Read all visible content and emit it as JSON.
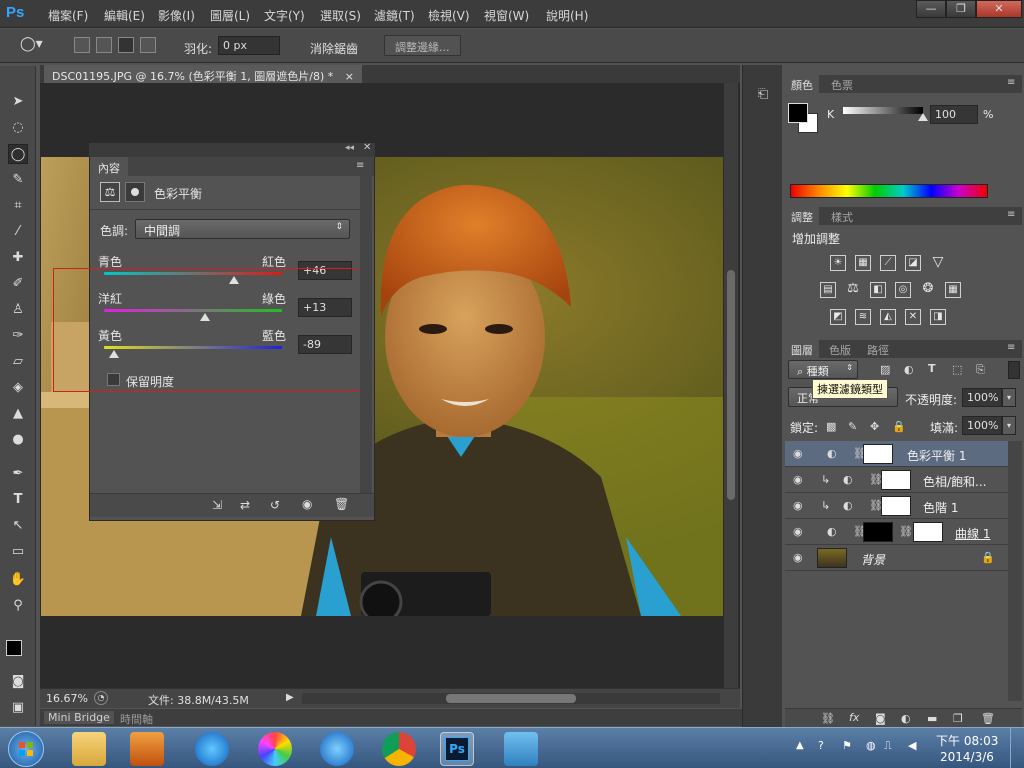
{
  "app": {
    "logo": "Ps"
  },
  "menu": [
    "檔案(F)",
    "編輯(E)",
    "影像(I)",
    "圖層(L)",
    "文字(Y)",
    "選取(S)",
    "濾鏡(T)",
    "檢視(V)",
    "視窗(W)",
    "說明(H)"
  ],
  "window_controls": {
    "minimize": "—",
    "restore": "❐",
    "close": "✕"
  },
  "options_bar": {
    "feather_label": "羽化:",
    "feather_value": "0 px",
    "antialias_label": "消除鋸齒",
    "antialias_checked": "✓",
    "refine_edge_button": "調整邊緣..."
  },
  "document": {
    "tab_title": "DSC01195.JPG @ 16.7% (色彩平衡 1, 圖層遮色片/8) *",
    "tab_close": "×",
    "zoom": "16.67%",
    "file_info": "文件: 38.8M/43.5M"
  },
  "bottom_tabs": [
    "Mini Bridge",
    "時間軸"
  ],
  "properties": {
    "tab_label": "內容",
    "adjustment_title": "色彩平衡",
    "tone_label": "色調:",
    "tone_value": "中間調",
    "sliders": [
      {
        "left": "青色",
        "right": "紅色",
        "value": "+46",
        "fraction": 0.73,
        "gradient": [
          "#00c8c8",
          "#e01818"
        ]
      },
      {
        "left": "洋紅",
        "right": "綠色",
        "value": "+13",
        "fraction": 0.565,
        "gradient": [
          "#e020e0",
          "#20c020"
        ]
      },
      {
        "left": "黃色",
        "right": "藍色",
        "value": "-89",
        "fraction": 0.055,
        "gradient": [
          "#e0e020",
          "#2020e0"
        ]
      }
    ],
    "preserve_label": "保留明度"
  },
  "color_panel": {
    "tabs": [
      "顏色",
      "色票"
    ],
    "channel_label": "K",
    "value": "100",
    "unit": "%",
    "slider_fraction": 1.0
  },
  "adjustments_panel": {
    "tabs": [
      "調整",
      "樣式"
    ],
    "heading": "增加調整",
    "icons_row1": [
      "brightness-icon",
      "levels-icon",
      "curves-icon",
      "exposure-icon",
      "vibrance-icon"
    ],
    "icons_row2": [
      "hue-saturation-icon",
      "color-balance-icon",
      "black-white-icon",
      "photo-filter-icon",
      "channel-mixer-icon",
      "color-lookup-icon"
    ],
    "icons_row3": [
      "invert-icon",
      "posterize-icon",
      "threshold-icon",
      "gradient-map-icon",
      "selective-color-icon"
    ]
  },
  "layers_panel": {
    "tabs": [
      "圖層",
      "色版",
      "路徑"
    ],
    "filter_kind": "種類",
    "tooltip": "揀選濾鏡類型",
    "blend_mode": "正常",
    "opacity_label": "不透明度:",
    "opacity_value": "100%",
    "lock_label": "鎖定:",
    "fill_label": "填滿:",
    "fill_value": "100%",
    "layers": [
      {
        "name": "色彩平衡 1",
        "selected": true,
        "clipped": false
      },
      {
        "name": "色相/飽和...",
        "selected": false,
        "clipped": true
      },
      {
        "name": "色階 1",
        "selected": false,
        "clipped": true
      },
      {
        "name": "曲線 1",
        "selected": false,
        "clipped": false
      },
      {
        "name": "背景",
        "selected": false,
        "clipped": false
      }
    ]
  },
  "taskbar": {
    "time": "下午 08:03",
    "date": "2014/3/6"
  },
  "colors": {
    "accent_ps": "#31a8ff",
    "selection": "#5c6b80",
    "annotation_box": "#d02020"
  }
}
